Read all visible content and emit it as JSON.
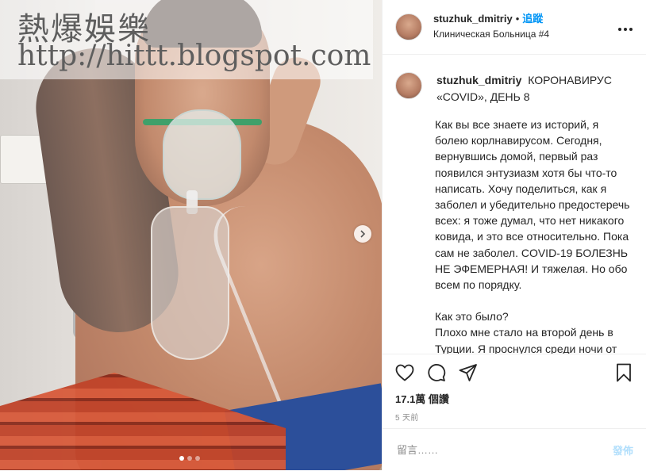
{
  "watermark": {
    "line1": "熱爆娛樂",
    "line2": "http://hittt.blogspot.com"
  },
  "carousel": {
    "next_icon": "chevron-right-icon",
    "dots": 3,
    "active_dot": 0
  },
  "header": {
    "username": "stuzhuk_dmitriy",
    "separator": "•",
    "follow_label": "追蹤",
    "location": "Клиническая Больница #4",
    "more_icon": "more-horizontal-icon"
  },
  "caption": {
    "username": "stuzhuk_dmitriy",
    "title": "КОРОНАВИРУС «COVID», ДЕНЬ 8",
    "paragraphs": [
      "Как вы все знаете из историй, я болею корлнавирусом. Сегодня, вернувшись домой, первый раз появился энтузиазм хотя бы что-то написать. Хочу поделиться, как я заболел и убедительно предостеречь всех: я тоже думал, что нет никакого ковида, и это все относительно. Пока сам не заболел. COVID-19 БОЛЕЗНЬ НЕ ЭФЕМЕРНАЯ! И тяжелая. Но обо всем по порядку.",
      "Как это было?",
      "Плохо мне стало на второй день в Турции. Я проснулся среди ночи от того, что у меня отекла шея и было тяжело дышать. При этом немного"
    ]
  },
  "actions": {
    "icons": [
      "heart-icon",
      "comment-icon",
      "share-icon",
      "bookmark-icon"
    ],
    "likes": "17.1萬 個讚",
    "age": "5 天前"
  },
  "comment": {
    "placeholder": "留言……",
    "post_label": "發佈"
  },
  "colors": {
    "link_blue": "#0095f6",
    "post_disabled": "#b2dffc",
    "muted": "#8e8e8e",
    "text": "#262626"
  }
}
